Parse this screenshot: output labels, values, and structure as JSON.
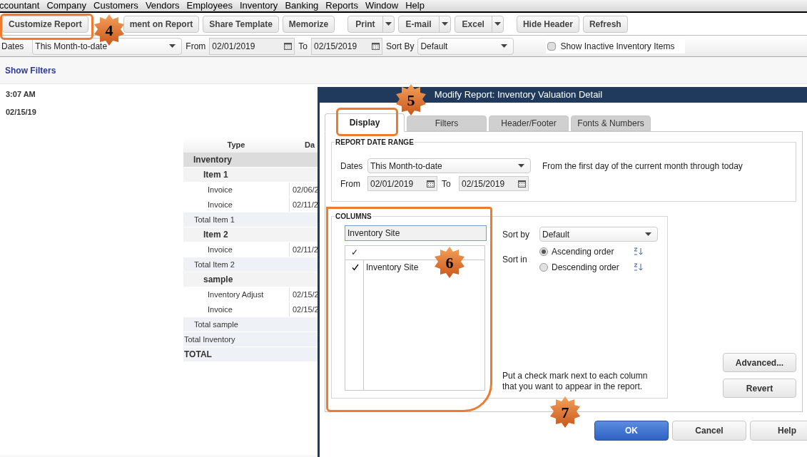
{
  "menu": [
    "ccountant",
    "Company",
    "Customers",
    "Vendors",
    "Employees",
    "Inventory",
    "Banking",
    "Reports",
    "Window",
    "Help"
  ],
  "toolbar": [
    [
      {
        "label": "Customize Report",
        "kind": "plain"
      },
      {
        "label": "ment on Report",
        "kind": "plain"
      },
      {
        "label": "Share Template",
        "kind": "plain"
      },
      {
        "label": "Memorize",
        "kind": "plain"
      }
    ],
    [
      {
        "label": "Print",
        "kind": "split"
      },
      {
        "label": "E-mail",
        "kind": "split"
      },
      {
        "label": "Excel",
        "kind": "split"
      }
    ],
    [
      {
        "label": "Hide Header",
        "kind": "plain"
      },
      {
        "label": "Refresh",
        "kind": "plain"
      }
    ]
  ],
  "filters": {
    "dates_label": "Dates",
    "dates": "This Month-to-date",
    "from_label": "From",
    "from": "02/01/2019",
    "to_label": "To",
    "to": "02/15/2019",
    "sort_label": "Sort By",
    "sort": "Default",
    "inactive": {
      "label": "Show Inactive Inventory Items",
      "checked": false
    }
  },
  "show_filters": "Show Filters",
  "report": {
    "time": "3:07 AM",
    "date": "02/15/19",
    "columns": [
      "Type",
      "Da"
    ],
    "sections": [
      {
        "label": "Inventory",
        "children": [
          {
            "label": "Item 1",
            "rows": [
              {
                "type": "Invoice",
                "date": "02/06/2"
              },
              {
                "type": "Invoice",
                "date": "02/11/2"
              }
            ],
            "total": "Total Item 1"
          },
          {
            "label": "Item 2",
            "rows": [
              {
                "type": "Invoice",
                "date": "02/11/2"
              }
            ],
            "total": "Total Item 2"
          },
          {
            "label": "sample",
            "rows": [
              {
                "type": "Inventory Adjust",
                "date": "02/15/2"
              },
              {
                "type": "Invoice",
                "date": "02/15/2"
              }
            ],
            "total": "Total sample"
          }
        ],
        "total": "Total Inventory"
      }
    ],
    "grand_total": "TOTAL"
  },
  "dialog": {
    "title": "Modify Report: Inventory Valuation Detail",
    "tabs": [
      {
        "label": "Display",
        "selected": true
      },
      {
        "label": "Filters",
        "selected": false
      },
      {
        "label": "Header/Footer",
        "selected": false
      },
      {
        "label": "Fonts & Numbers",
        "selected": false
      }
    ],
    "date_range": {
      "heading": "REPORT DATE RANGE",
      "dates_label": "Dates",
      "dates": "This Month-to-date",
      "hint": "From the first day of the current month through today",
      "from_label": "From",
      "from": "02/01/2019",
      "to_label": "To",
      "to": "02/15/2019"
    },
    "columns": {
      "heading": "COLUMNS",
      "search": "Inventory Site",
      "check_header": "✓",
      "items": [
        {
          "label": "Inventory Site",
          "checked": true
        }
      ],
      "sort_by_label": "Sort by",
      "sort_by": "Default",
      "sort_in_label": "Sort in",
      "orders": [
        {
          "label": "Ascending order",
          "selected": true
        },
        {
          "label": "Descending order",
          "selected": false
        }
      ],
      "note": "Put a check mark next to each column that you want to appear in the report."
    },
    "side_buttons": [
      "Advanced...",
      "Revert"
    ],
    "buttons": [
      {
        "label": "OK",
        "primary": true
      },
      {
        "label": "Cancel",
        "primary": false
      },
      {
        "label": "Help",
        "primary": false
      }
    ]
  },
  "steps": [
    "4",
    "5",
    "6",
    "7"
  ]
}
